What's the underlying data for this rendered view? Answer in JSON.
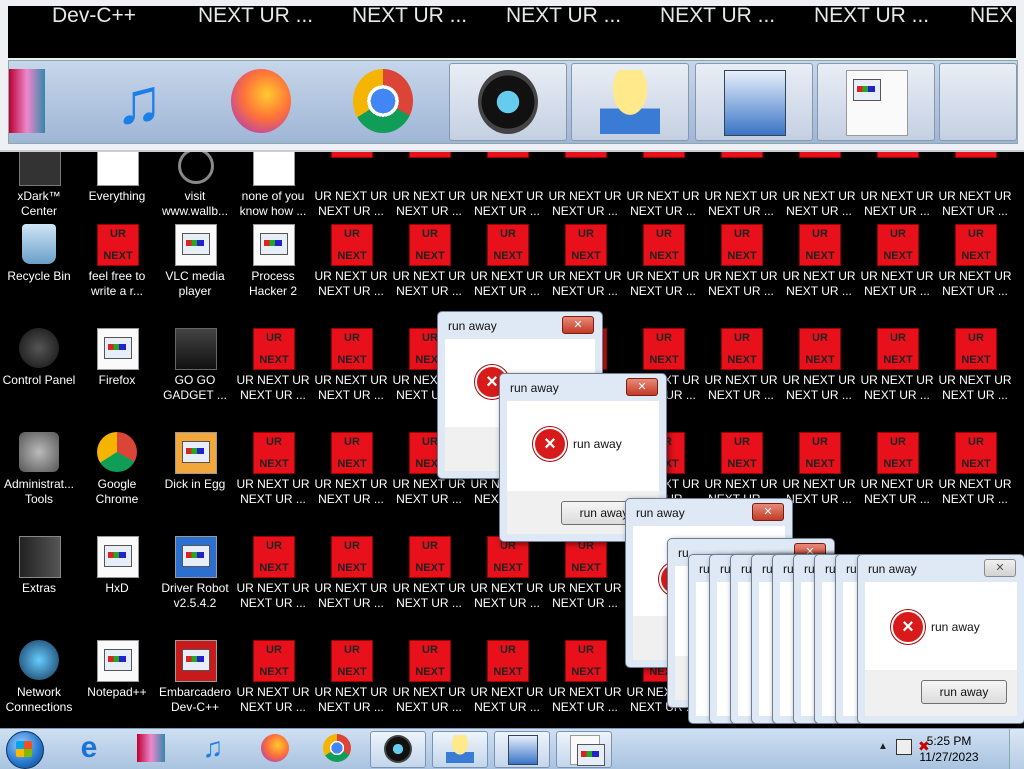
{
  "thumb_titles": [
    "Dev-C++",
    "NEXT UR ...",
    "NEXT UR ...",
    "NEXT UR ...",
    "NEXT UR ...",
    "NEXT UR ...",
    "NEX"
  ],
  "desktop": {
    "col1": [
      "xDark™\nCenter",
      "Recycle Bin",
      "Control Panel",
      "Administrat...\nTools",
      "Extras",
      "Network\nConnections"
    ],
    "col2": [
      "Everything",
      "feel free to\nwrite a r...",
      "Firefox",
      "Google\nChrome",
      "HxD",
      "Notepad++"
    ],
    "col3": [
      "visit\nwww.wallb...",
      "VLC media\nplayer",
      "GO GO\nGADGET ...",
      "Dick in Egg",
      "Driver Robot\nv2.5.4.2",
      "Embarcadero\nDev-C++"
    ],
    "col4": [
      "none of you\nknow how ...",
      "Process\nHacker 2"
    ],
    "ur_label": "UR NEXT UR\nNEXT UR ...",
    "ur_top": "UR",
    "ur_bottom": "NEXT",
    "next_partial": "NEXT UR ..."
  },
  "dialogs": {
    "title": "run away",
    "message": "run away",
    "button": "run away",
    "close": "✕",
    "stack_caption": "ru"
  },
  "taskbar": {
    "time": "5:25 PM",
    "date": "11/27/2023"
  },
  "colors": {
    "ur_red": "#e8101a",
    "taskbar": "#bcd2ea",
    "error_red": "#d91a1a"
  }
}
